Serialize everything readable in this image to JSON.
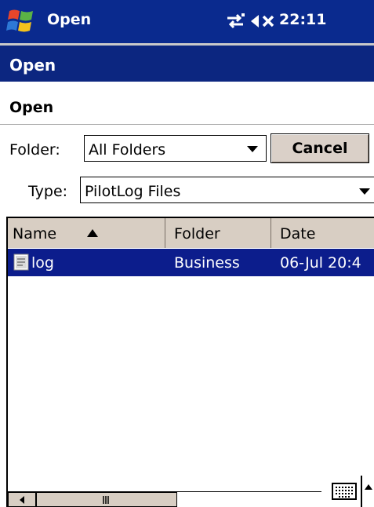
{
  "titlebar": {
    "title": "Open",
    "time": "22:11"
  },
  "header": {
    "label": "Open"
  },
  "dialog": {
    "subtitle": "Open",
    "folder_label": "Folder:",
    "folder_value": "All Folders",
    "type_label": "Type:",
    "type_value": "PilotLog Files",
    "cancel_label": "Cancel"
  },
  "list": {
    "columns": [
      "Name",
      "Folder",
      "Date"
    ],
    "rows": [
      {
        "name": "log",
        "folder": "Business",
        "date": "06-Jul 20:4"
      }
    ]
  },
  "colors": {
    "titlebar": "#0a2a8e",
    "selection": "#0c1d8c",
    "button_face": "#dad0c8"
  }
}
